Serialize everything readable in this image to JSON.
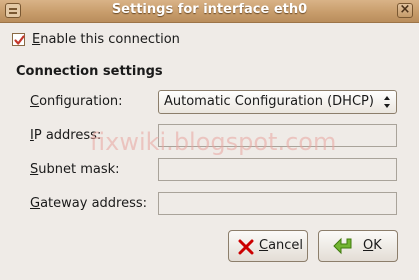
{
  "window": {
    "title": "Settings for interface eth0",
    "close_glyph": "×"
  },
  "enable": {
    "label": "Enable this connection",
    "checked": true
  },
  "section": {
    "title": "Connection settings"
  },
  "fields": {
    "configuration": {
      "label": "Configuration:",
      "value": "Automatic Configuration (DHCP)"
    },
    "ip_address": {
      "label": "IP address:",
      "value": ""
    },
    "subnet_mask": {
      "label": "Subnet mask:",
      "value": ""
    },
    "gateway": {
      "label": "Gateway address:",
      "value": ""
    }
  },
  "buttons": {
    "cancel": "Cancel",
    "ok": "OK"
  },
  "watermark": "fixwiki.blogspot.com",
  "colors": {
    "titlebar": "#c89d6c",
    "window_bg": "#efebe7",
    "check_mark": "#c4372b",
    "ok_arrow": "#4e9a06",
    "cancel_x": "#cc0000"
  }
}
